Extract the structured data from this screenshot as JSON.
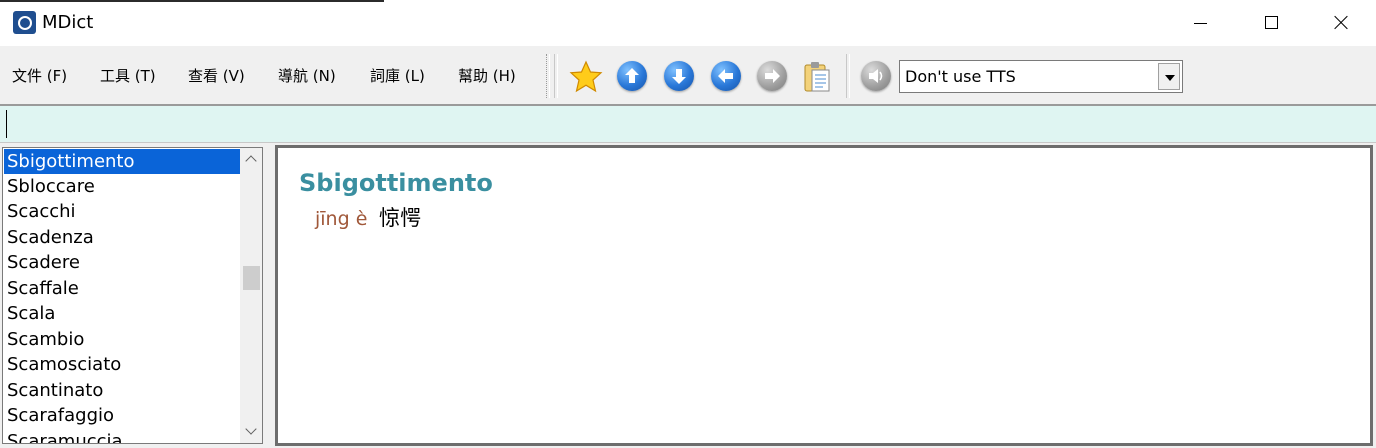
{
  "window": {
    "title": "MDict",
    "controls": [
      "minimize",
      "maximize",
      "close"
    ]
  },
  "menu": [
    {
      "label": "文件 (F)"
    },
    {
      "label": "工具 (T)"
    },
    {
      "label": "查看 (V)"
    },
    {
      "label": "導航 (N)"
    },
    {
      "label": "詞庫 (L)"
    },
    {
      "label": "幫助 (H)"
    }
  ],
  "toolbar": {
    "buttons": [
      {
        "name": "favorite-star",
        "icon": "star-icon"
      },
      {
        "name": "previous-entry",
        "icon": "arrow-up-icon"
      },
      {
        "name": "next-entry",
        "icon": "arrow-down-icon"
      },
      {
        "name": "back",
        "icon": "arrow-left-icon"
      },
      {
        "name": "forward",
        "icon": "arrow-right-icon"
      },
      {
        "name": "clipboard",
        "icon": "clipboard-icon"
      },
      {
        "name": "speak",
        "icon": "speaker-icon"
      }
    ],
    "tts": {
      "selected": "Don't use TTS"
    }
  },
  "search": {
    "value": "",
    "placeholder": ""
  },
  "wordlist": {
    "selected_index": 0,
    "items": [
      "Sbigottimento",
      "Sbloccare",
      "Scacchi",
      "Scadenza",
      "Scadere",
      "Scaffale",
      "Scala",
      "Scambio",
      "Scamosciato",
      "Scantinato",
      "Scarafaggio",
      "Scaramuccia"
    ]
  },
  "entry": {
    "headword": "Sbigottimento",
    "pinyin": "jīng è",
    "translation": "惊愕"
  },
  "colors": {
    "selection": "#0a64d8",
    "headword": "#3a8fa0",
    "pinyin": "#a0583a",
    "search_bg": "#dff5f2"
  }
}
